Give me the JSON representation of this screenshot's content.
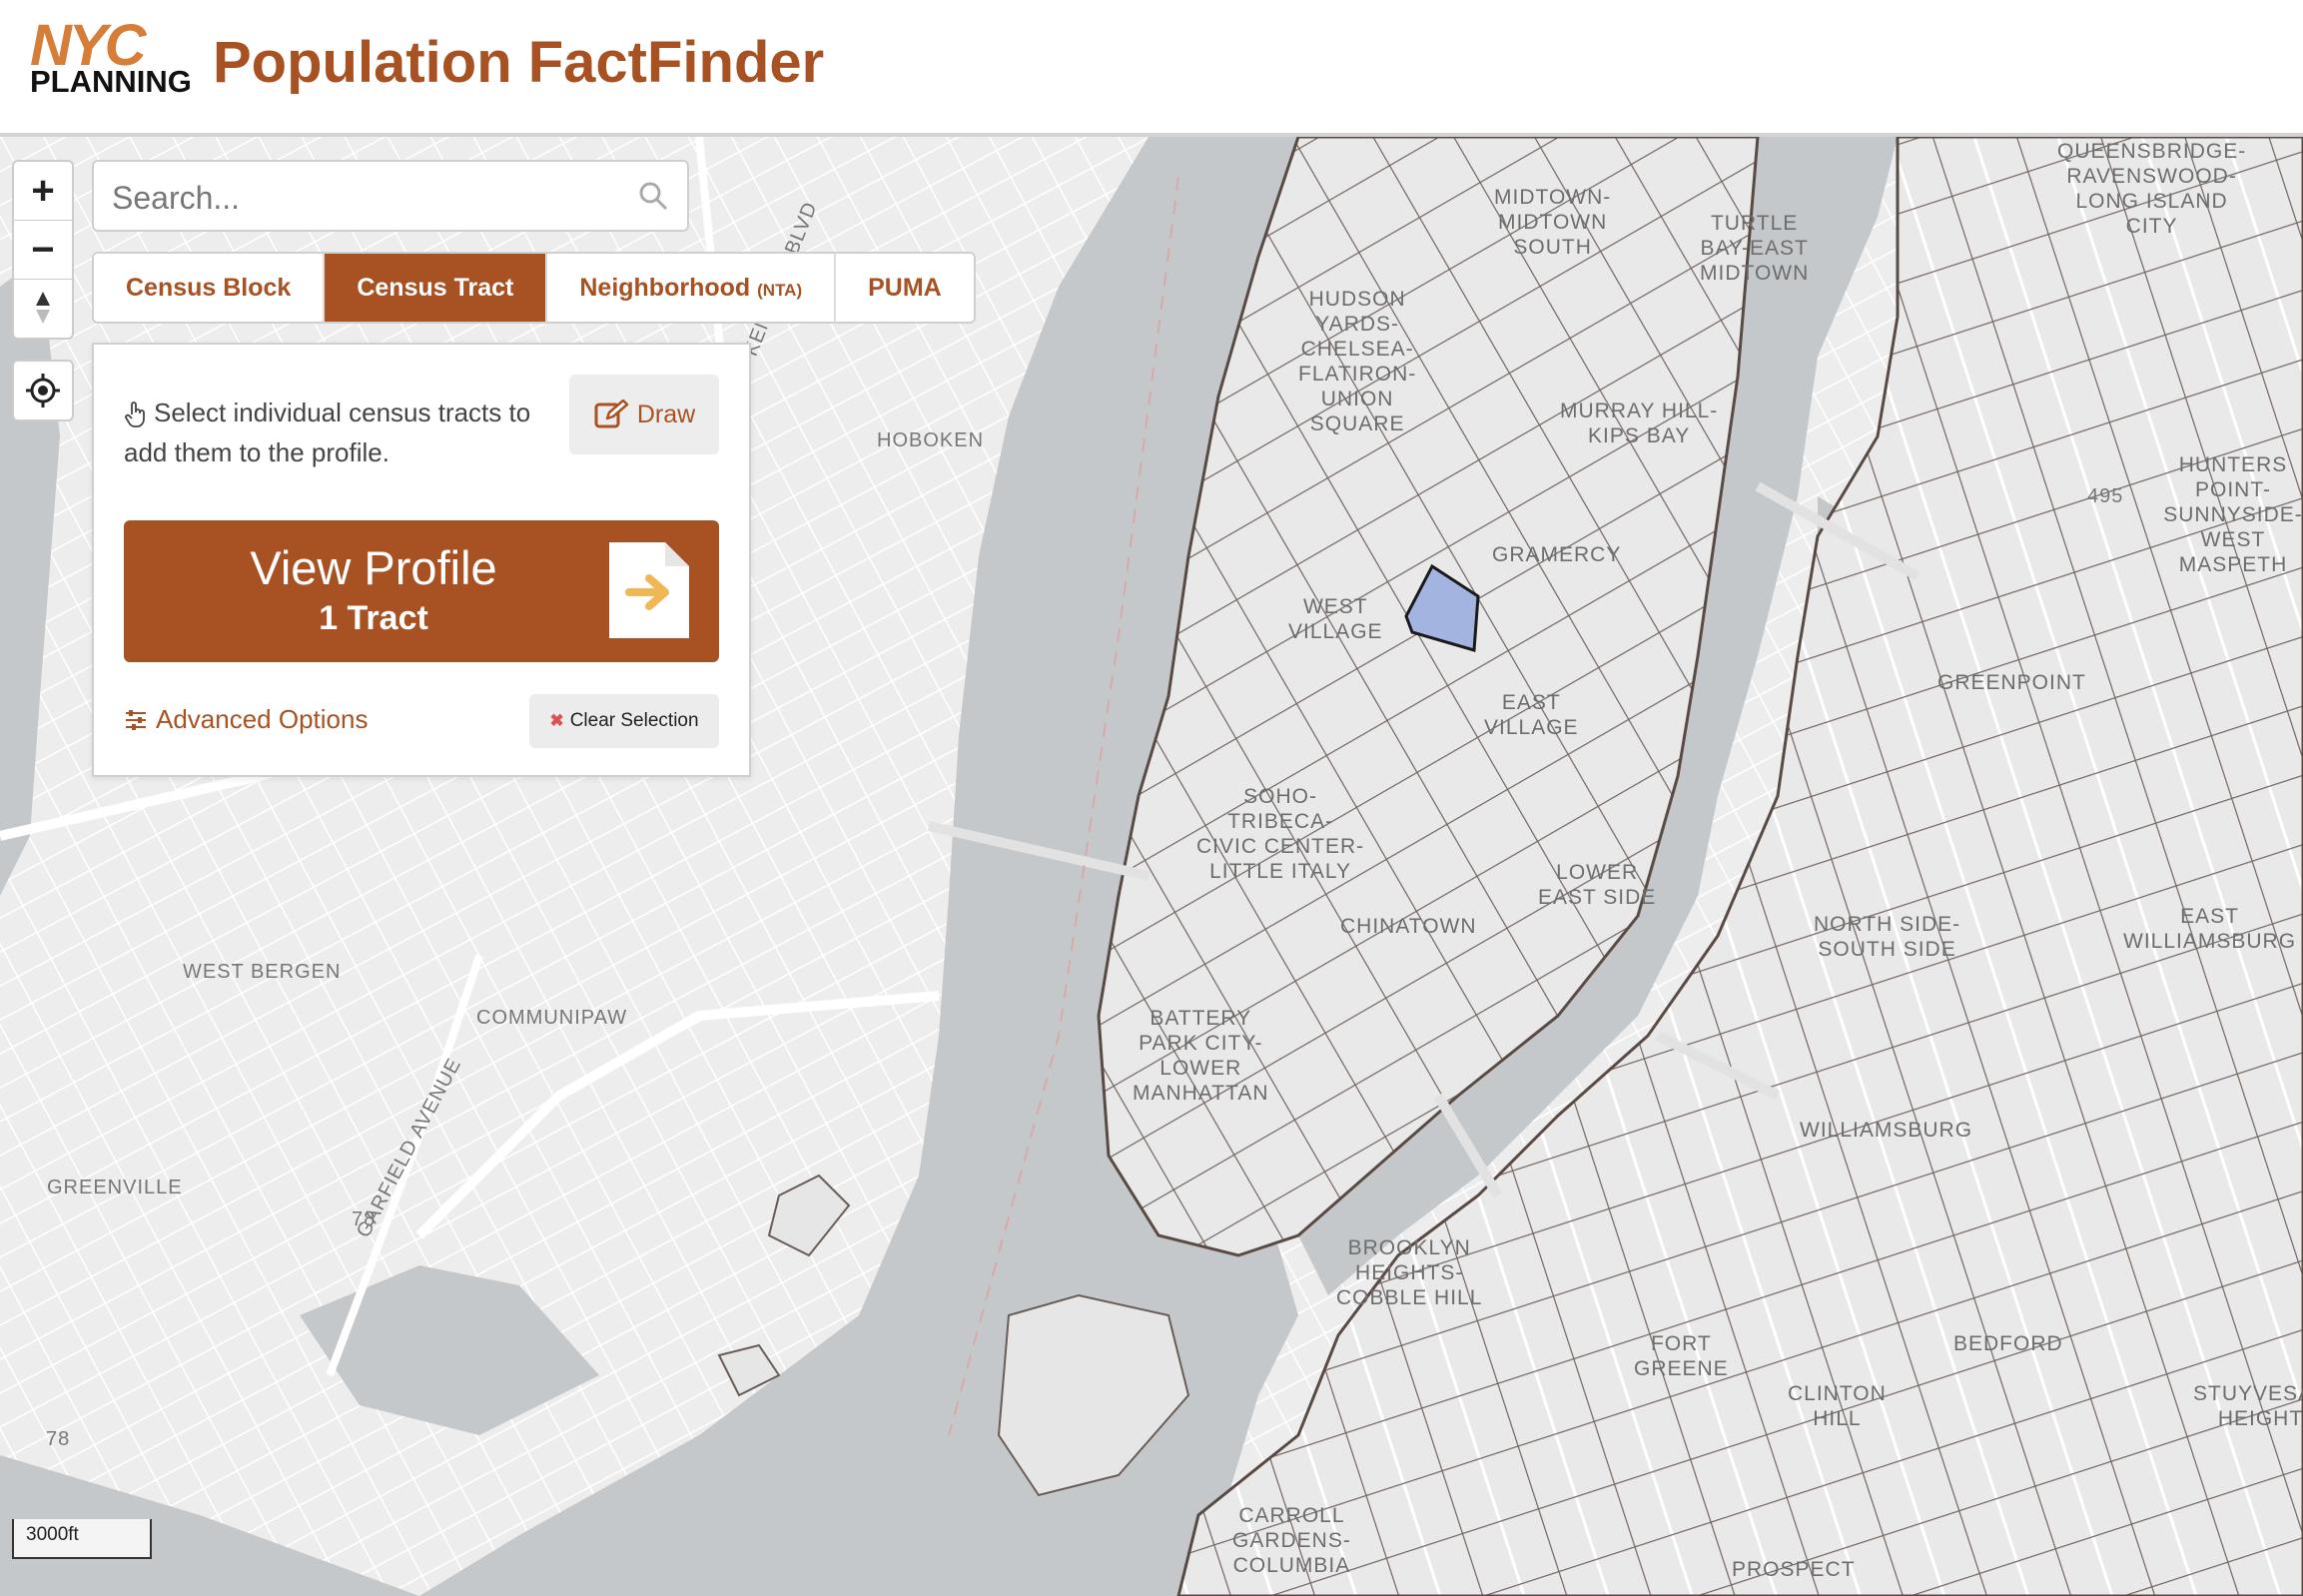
{
  "header": {
    "logo_top": "NYC",
    "logo_bottom": "PLANNING",
    "title": "Population FactFinder"
  },
  "map_controls": {
    "zoom_in": "+",
    "zoom_out": "−",
    "compass": "▲▼"
  },
  "search": {
    "placeholder": "Search..."
  },
  "tabs": [
    {
      "label": "Census Block",
      "suffix": "",
      "active": false
    },
    {
      "label": "Census Tract",
      "suffix": "",
      "active": true
    },
    {
      "label": "Neighborhood",
      "suffix": "(NTA)",
      "active": false
    },
    {
      "label": "PUMA",
      "suffix": "",
      "active": false
    }
  ],
  "panel": {
    "instruction": "Select individual census tracts to add them to the profile.",
    "draw_label": "Draw",
    "view_profile_title": "View Profile",
    "view_profile_sub": "1 Tract",
    "advanced_label": "Advanced Options",
    "clear_label": "Clear Selection"
  },
  "scale_label": "3000ft",
  "map_labels": {
    "hoboken": "HOBOKEN",
    "west_bergen": "WEST BERGEN",
    "communipaw": "COMMUNIPAW",
    "greenville": "GREENVILLE",
    "hudson_yards": "HUDSON\nYARDS-\nCHELSEA-\nFLATIRON-\nUNION\nSQUARE",
    "midtown": "MIDTOWN-\nMIDTOWN\nSOUTH",
    "turtle_bay": "TURTLE\nBAY-EAST\nMIDTOWN",
    "queensbridge": "QUEENSBRIDGE-\nRAVENSWOOD-\nLONG ISLAND\nCITY",
    "murray_hill": "MURRAY HILL-\nKIPS BAY",
    "gramercy": "GRAMERCY",
    "west_village": "WEST\nVILLAGE",
    "east_village": "EAST\nVILLAGE",
    "soho": "SOHO-\nTRIBECA-\nCIVIC CENTER-\nLITTLE ITALY",
    "lower_east_side": "LOWER\nEAST SIDE",
    "chinatown": "CHINATOWN",
    "battery_park": "BATTERY\nPARK CITY-\nLOWER\nMANHATTAN",
    "greenpoint": "GREENPOINT",
    "north_side": "NORTH SIDE-\nSOUTH SIDE",
    "east_williamsburg": "EAST\nWILLIAMSBURG",
    "williamsburg": "WILLIAMSBURG",
    "brooklyn_heights": "BROOKLYN\nHEIGHTS-\nCOBBLE HILL",
    "fort_greene": "FORT\nGREENE",
    "clinton_hill": "CLINTON\nHILL",
    "bedford": "BEDFORD",
    "stuyvesant": "STUYVESANT\nHEIGHTS",
    "carroll_gardens": "CARROLL\nGARDENS-\nCOLUMBIA",
    "prospect": "PROSPECT",
    "hunters_point": "HUNTERS\nPOINT-\nSUNNYSIDE-\nWEST MASPETH",
    "kennedy_blvd": "KENNEDY BLVD",
    "garfield_ave": "GARFIELD AVENUE",
    "route_78a": "78",
    "route_78b": "78",
    "route_495": "495"
  }
}
